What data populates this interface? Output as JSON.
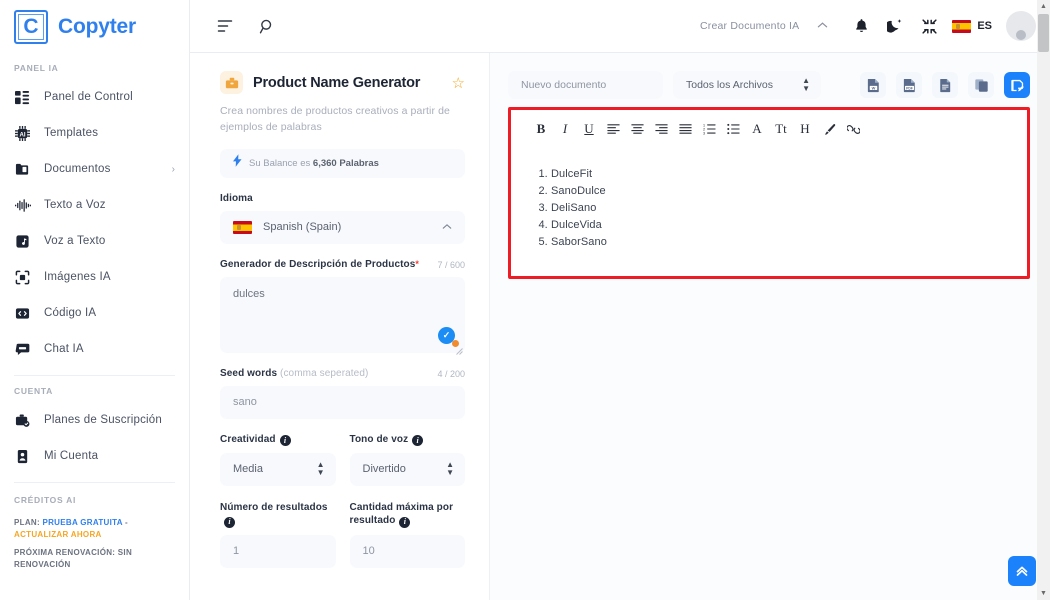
{
  "brand": {
    "mark": "C",
    "name": "Copyter"
  },
  "sidebar": {
    "sections": [
      {
        "title": "PANEL IA",
        "items": [
          {
            "label": "Panel de Control",
            "icon": "dashboard-icon",
            "chevron": ""
          },
          {
            "label": "Templates",
            "icon": "chip-ai-icon",
            "chevron": ""
          },
          {
            "label": "Documentos",
            "icon": "folder-document-icon",
            "chevron": "›"
          },
          {
            "label": "Texto a Voz",
            "icon": "waveform-icon",
            "chevron": ""
          },
          {
            "label": "Voz a Texto",
            "icon": "audio-file-icon",
            "chevron": ""
          },
          {
            "label": "Imágenes IA",
            "icon": "camera-focus-icon",
            "chevron": ""
          },
          {
            "label": "Código IA",
            "icon": "code-brackets-icon",
            "chevron": ""
          },
          {
            "label": "Chat IA",
            "icon": "chat-bubble-icon",
            "chevron": ""
          }
        ]
      },
      {
        "title": "CUENTA",
        "items": [
          {
            "label": "Planes de Suscripción",
            "icon": "subscription-icon",
            "chevron": ""
          },
          {
            "label": "Mi Cuenta",
            "icon": "id-card-icon",
            "chevron": ""
          }
        ]
      }
    ],
    "credits": {
      "title": "CRÉDITOS AI",
      "plan_prefix": "PLAN: ",
      "plan_value": "PRUEBA GRATUITA",
      "plan_sep": " - ",
      "plan_upgrade": "ACTUALIZAR AHORA",
      "renewal": "PRÓXIMA RENOVACIÓN: SIN RENOVACIÓN"
    }
  },
  "topbar": {
    "menu_icon": "menu-lines-icon",
    "search_icon": "search-icon",
    "create_doc_label": "Crear Documento IA",
    "collapse_caret": "⌃",
    "bell_icon": "bell-icon",
    "theme_icon": "moon-dark-mode-icon",
    "fullscreen_icon": "collapse-fullscreen-icon",
    "language_code": "ES",
    "avatar_icon": "user-avatar"
  },
  "form": {
    "template_icon": "toolbox-icon",
    "title": "Product Name Generator",
    "favorite_icon": "star-icon",
    "description": "Crea nombres de productos creativos a partir de ejemplos de palabras",
    "balance_icon": "lightning-icon",
    "balance_prefix": "Su Balance es ",
    "balance_value": "6,360 Palabras",
    "language_label": "Idioma",
    "language_value": "Spanish (Spain)",
    "prompt_label": "Generador de Descripción de Productos",
    "prompt_required": "*",
    "prompt_counter": "7 / 600",
    "prompt_value": "dulces",
    "seed_label": "Seed words",
    "seed_hint": "(comma seperated)",
    "seed_counter": "4 / 200",
    "seed_value": "sano",
    "creativity_label": "Creatividad",
    "creativity_value": "Media",
    "tone_label": "Tono de voz",
    "tone_value": "Divertido",
    "results_label": "Número de resultados",
    "results_value": "1",
    "max_label": "Cantidad máxima por resultado",
    "max_value": "10"
  },
  "editor": {
    "doc_name_placeholder": "Nuevo documento",
    "filter_value": "Todos los Archivos",
    "export_buttons": [
      {
        "name": "export-word-button",
        "glyph": "W"
      },
      {
        "name": "export-pdf-button",
        "glyph": "PDF"
      },
      {
        "name": "export-text-button",
        "glyph": "TXT"
      },
      {
        "name": "copy-button",
        "glyph": "COPY"
      },
      {
        "name": "save-document-button",
        "glyph": "SAVE"
      }
    ],
    "toolbar": [
      {
        "name": "bold-button",
        "label": "B",
        "style": "bold"
      },
      {
        "name": "italic-button",
        "label": "I",
        "style": "ital"
      },
      {
        "name": "underline-button",
        "label": "U",
        "style": "und"
      },
      {
        "name": "align-left-button",
        "label": "align-left-icon",
        "style": "icon"
      },
      {
        "name": "align-center-button",
        "label": "align-center-icon",
        "style": "icon"
      },
      {
        "name": "align-right-button",
        "label": "align-right-icon",
        "style": "icon"
      },
      {
        "name": "align-justify-button",
        "label": "align-justify-icon",
        "style": "icon"
      },
      {
        "name": "ordered-list-button",
        "label": "ordered-list-icon",
        "style": "icon"
      },
      {
        "name": "unordered-list-button",
        "label": "unordered-list-icon",
        "style": "icon"
      },
      {
        "name": "font-color-button",
        "label": "A",
        "style": "serif"
      },
      {
        "name": "font-size-button",
        "label": "Tt",
        "style": "serif"
      },
      {
        "name": "heading-button",
        "label": "H",
        "style": "serif"
      },
      {
        "name": "highlight-brush-button",
        "label": "brush-icon",
        "style": "icon"
      },
      {
        "name": "insert-link-button",
        "label": "link-icon",
        "style": "icon"
      }
    ],
    "results": [
      "DulceFit",
      "SanoDulce",
      "DeliSano",
      "DulceVida",
      "SaborSano"
    ],
    "scroll_top_icon": "double-chevron-up-icon",
    "highlight_color": "#ee1c25"
  },
  "colors": {
    "brand_blue": "#2f80ed",
    "accent_blue": "#1b82fb",
    "warning_orange": "#f5a623",
    "required_red": "#ef3e36"
  }
}
